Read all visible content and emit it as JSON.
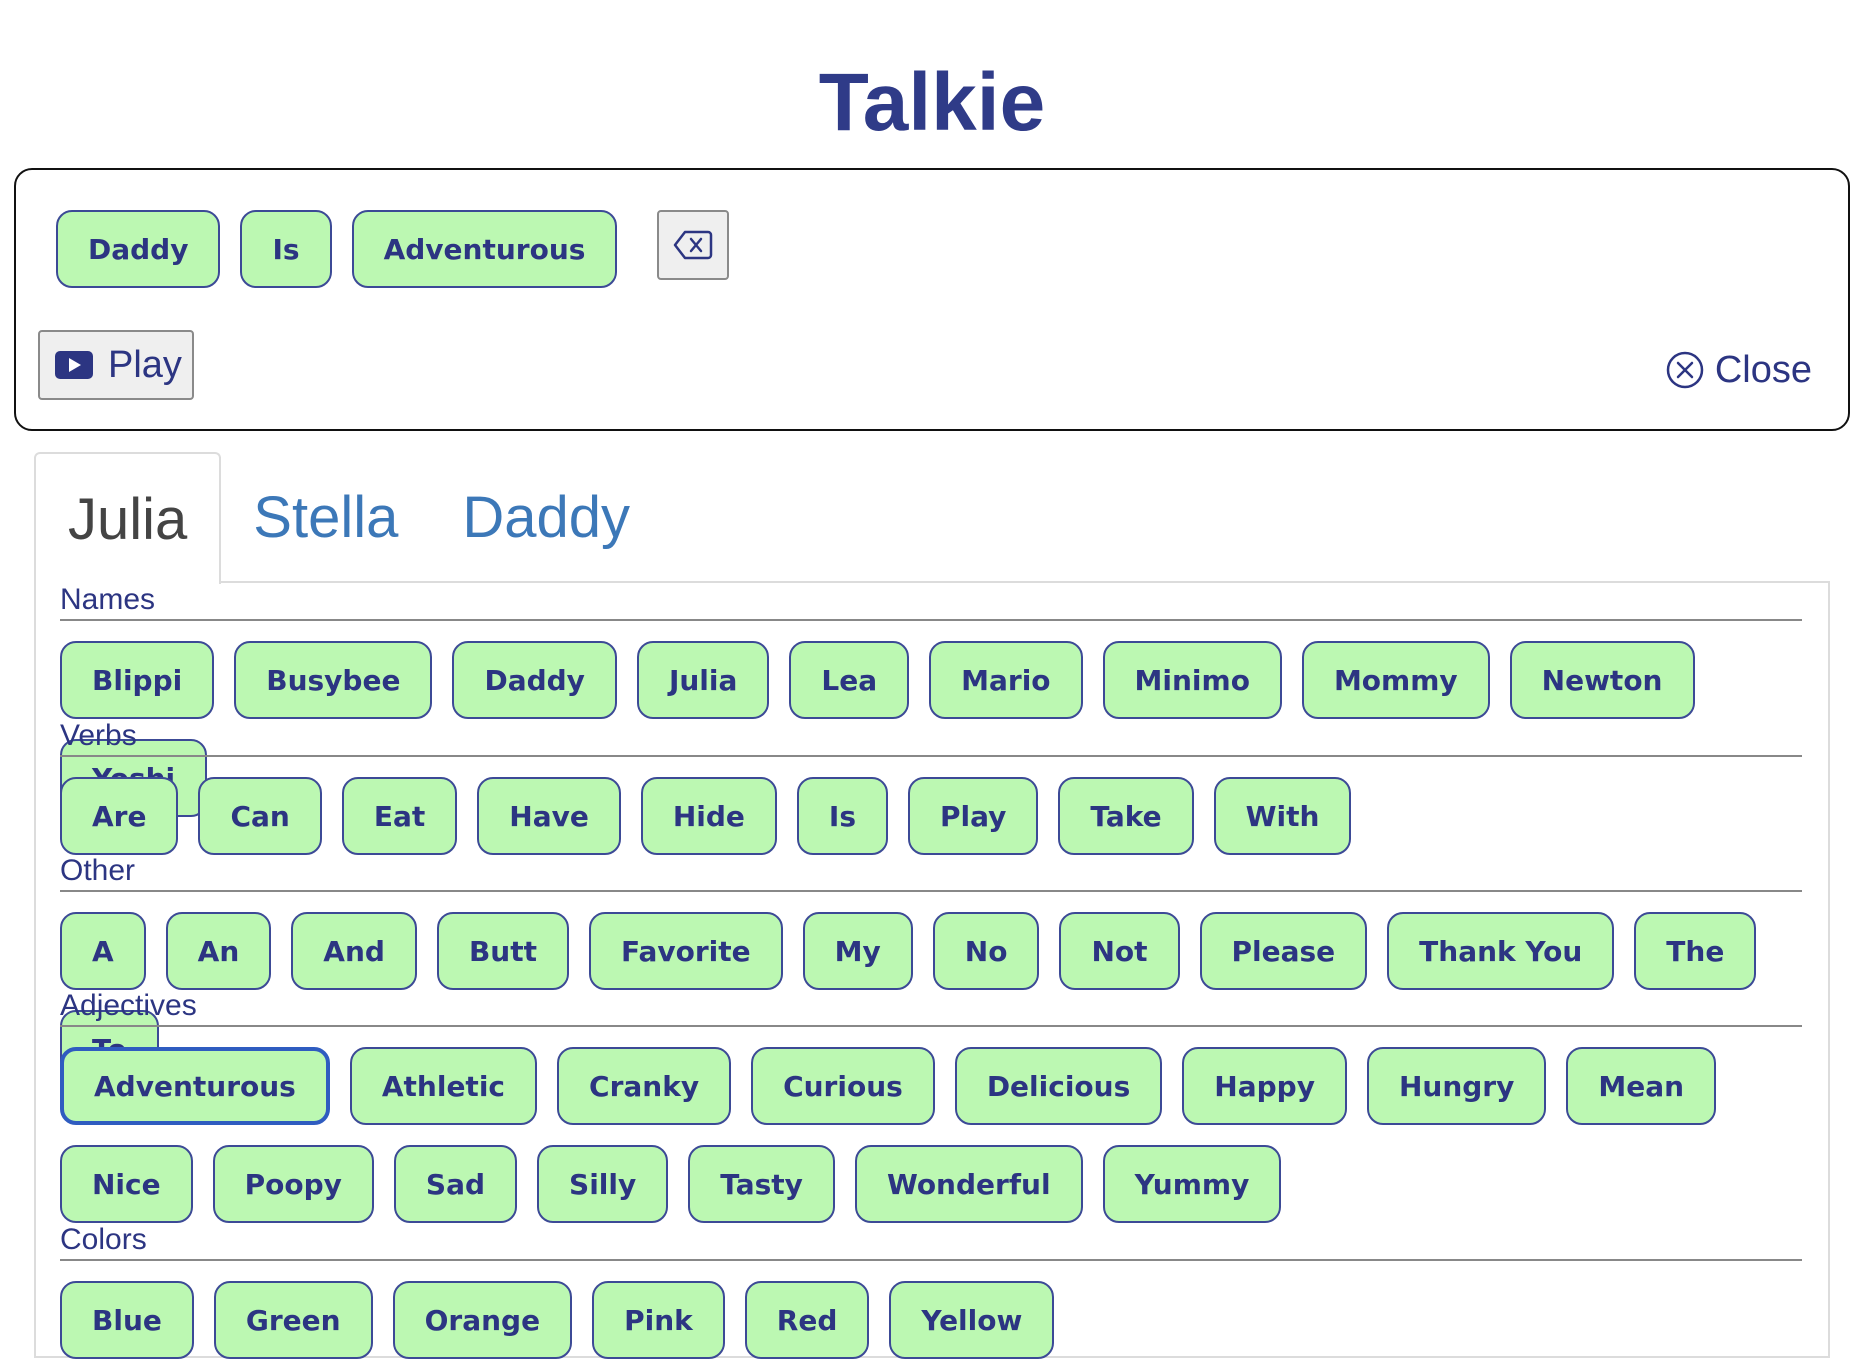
{
  "app": {
    "title": "Talkie"
  },
  "sentence": {
    "words": [
      "Daddy",
      "Is",
      "Adventurous"
    ],
    "play_label": "Play",
    "close_label": "Close"
  },
  "tabs": [
    {
      "label": "Julia",
      "active": true
    },
    {
      "label": "Stella",
      "active": false
    },
    {
      "label": "Daddy",
      "active": false
    }
  ],
  "categories": [
    {
      "label": "Names",
      "words": [
        "Blippi",
        "Busybee",
        "Daddy",
        "Julia",
        "Lea",
        "Mario",
        "Minimo",
        "Mommy",
        "Newton",
        "Yoshi"
      ]
    },
    {
      "label": "Verbs",
      "words": [
        "Are",
        "Can",
        "Eat",
        "Have",
        "Hide",
        "Is",
        "Play",
        "Take",
        "With"
      ]
    },
    {
      "label": "Other",
      "words": [
        "A",
        "An",
        "And",
        "Butt",
        "Favorite",
        "My",
        "No",
        "Not",
        "Please",
        "Thank You",
        "The",
        "To"
      ]
    },
    {
      "label": "Adjectives",
      "selected": "Adventurous",
      "words": [
        "Adventurous",
        "Athletic",
        "Cranky",
        "Curious",
        "Delicious",
        "Happy",
        "Hungry",
        "Mean",
        "Nice",
        "Poopy",
        "Sad",
        "Silly",
        "Tasty",
        "Wonderful",
        "Yummy"
      ]
    },
    {
      "label": "Colors",
      "words": [
        "Blue",
        "Green",
        "Orange",
        "Pink",
        "Red",
        "Yellow"
      ]
    }
  ],
  "colors": {
    "chip_fill": "#bcf8b2",
    "chip_border": "#3c4a96",
    "text_primary": "#2c3582",
    "tab_link": "#3c78b8"
  },
  "icons": {
    "backspace": "backspace-icon",
    "play": "play-icon",
    "close": "close-circle-icon"
  }
}
